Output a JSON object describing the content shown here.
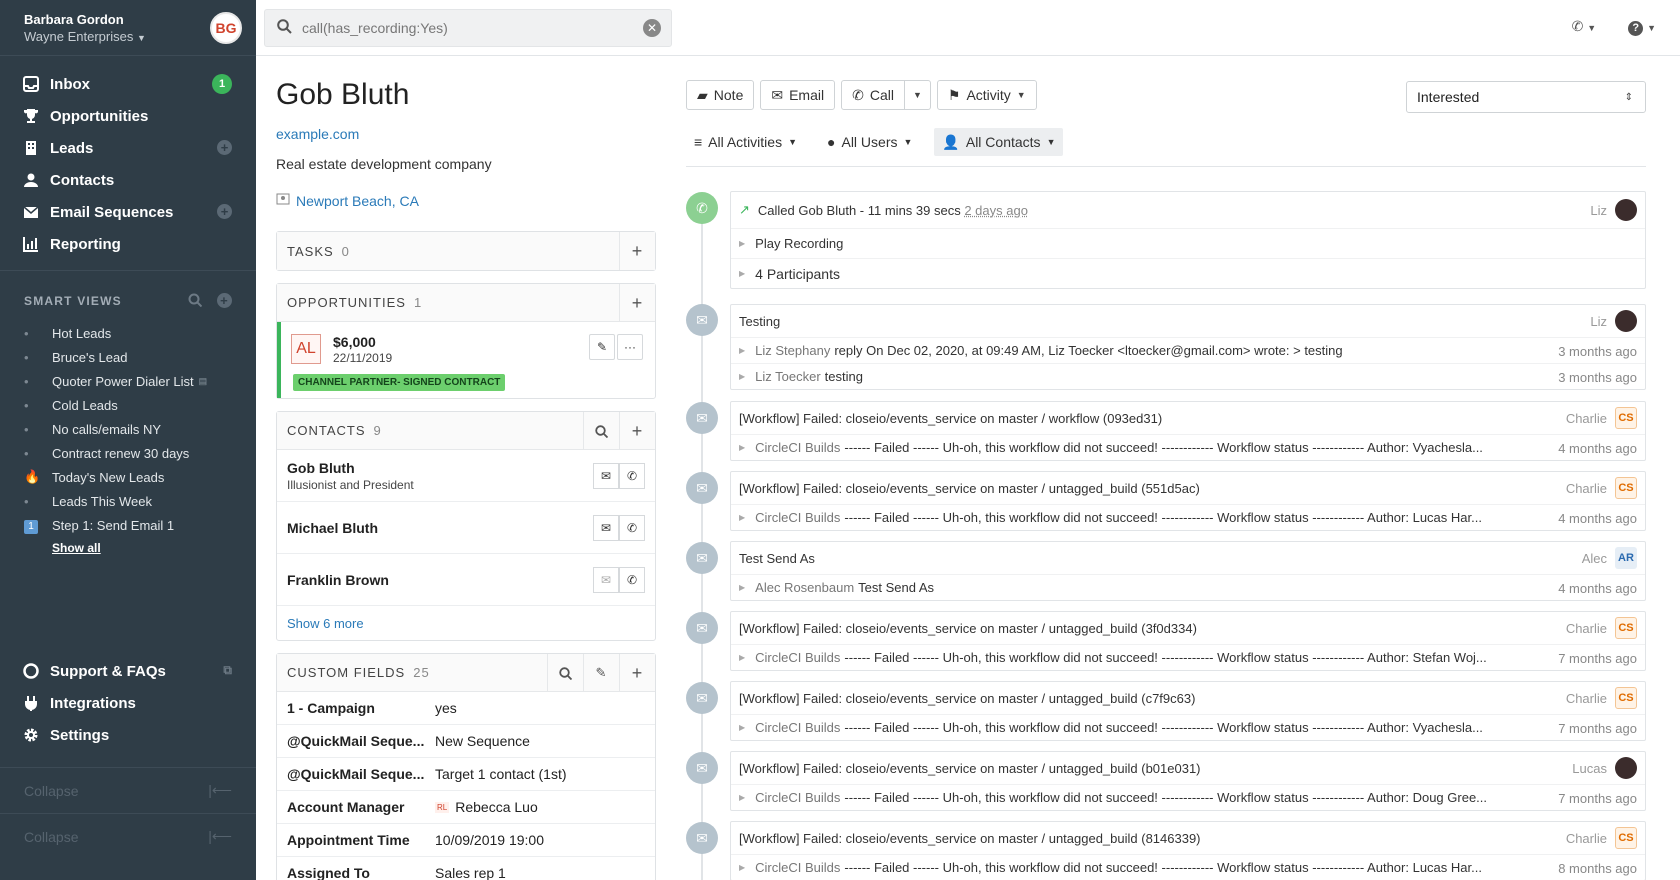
{
  "user": {
    "name": "Barbara Gordon",
    "org": "Wayne Enterprises",
    "initials": "BG"
  },
  "nav": {
    "inbox": "Inbox",
    "inbox_badge": "1",
    "opportunities": "Opportunities",
    "leads": "Leads",
    "contacts": "Contacts",
    "email_sequences": "Email Sequences",
    "reporting": "Reporting"
  },
  "smart_views": {
    "heading": "SMART VIEWS",
    "items": [
      "Hot Leads",
      "Bruce's Lead",
      "Quoter Power Dialer List",
      "Cold Leads",
      "No calls/emails NY",
      "Contract renew 30 days",
      "Today's New Leads",
      "Leads This Week",
      "Step 1: Send Email 1"
    ],
    "show_all": "Show all"
  },
  "bottom_nav": {
    "support": "Support & FAQs",
    "integrations": "Integrations",
    "settings": "Settings",
    "collapse": "Collapse"
  },
  "search": {
    "value": "call(has_recording:Yes)"
  },
  "lead": {
    "name": "Gob Bluth",
    "url": "example.com",
    "description": "Real estate development company",
    "location": "Newport Beach, CA"
  },
  "tasks": {
    "label": "TASKS",
    "count": "0"
  },
  "opportunities": {
    "label": "OPPORTUNITIES",
    "count": "1",
    "item": {
      "initials": "AL",
      "value": "$6,000",
      "date": "22/11/2019",
      "status": "CHANNEL PARTNER- SIGNED CONTRACT"
    }
  },
  "contacts": {
    "label": "CONTACTS",
    "count": "9",
    "items": [
      {
        "name": "Gob Bluth",
        "title": "Illusionist and President"
      },
      {
        "name": "Michael Bluth",
        "title": ""
      },
      {
        "name": "Franklin Brown",
        "title": ""
      }
    ],
    "show_more": "Show 6 more"
  },
  "custom_fields": {
    "label": "CUSTOM FIELDS",
    "count": "25",
    "rows": [
      {
        "key": "1 - Campaign",
        "value": "yes"
      },
      {
        "key": "@QuickMail Seque...",
        "value": "New Sequence"
      },
      {
        "key": "@QuickMail Seque...",
        "value": "Target 1 contact (1st)"
      },
      {
        "key": "Account Manager",
        "value": "Rebecca Luo",
        "badge": "RL"
      },
      {
        "key": "Appointment Time",
        "value": "10/09/2019 19:00"
      },
      {
        "key": "Assigned To",
        "value": "Sales rep 1"
      }
    ]
  },
  "actions": {
    "note": "Note",
    "email": "Email",
    "call": "Call",
    "activity": "Activity",
    "status": "Interested"
  },
  "filters": {
    "activities": "All Activities",
    "users": "All Users",
    "contacts": "All Contacts"
  },
  "feed": [
    {
      "type": "call",
      "title": "Called Gob Bluth - 11 mins 39 secs",
      "time": "2 days ago",
      "user": "Liz",
      "subs": [
        {
          "body": "Play Recording"
        },
        {
          "body": "4 Participants"
        }
      ]
    },
    {
      "type": "email",
      "title": "Testing",
      "user": "Liz",
      "subs": [
        {
          "who": "Liz Stephany",
          "body": "reply On Dec 02, 2020, at 09:49 AM, Liz Toecker <ltoecker@gmail.com> wrote: > testing",
          "time": "3 months ago"
        },
        {
          "who": "Liz Toecker",
          "body": "testing",
          "time": "3 months ago"
        }
      ]
    },
    {
      "type": "email",
      "title": "[Workflow] Failed: closeio/events_service on master / workflow (093ed31)",
      "user": "Charlie",
      "badge": "CS",
      "subs": [
        {
          "who": "CircleCI Builds",
          "body": "------ Failed ------ Uh-oh, this workflow did not succeed! ------------ Workflow status ------------ Author: Vyachesla...",
          "time": "4 months ago"
        }
      ]
    },
    {
      "type": "email",
      "title": "[Workflow] Failed: closeio/events_service on master / untagged_build (551d5ac)",
      "user": "Charlie",
      "badge": "CS",
      "subs": [
        {
          "who": "CircleCI Builds",
          "body": "------ Failed ------ Uh-oh, this workflow did not succeed! ------------ Workflow status ------------ Author: Lucas Har...",
          "time": "4 months ago"
        }
      ]
    },
    {
      "type": "email",
      "title": "Test Send As",
      "user": "Alec",
      "badge": "AR",
      "subs": [
        {
          "who": "Alec Rosenbaum",
          "body": "Test Send As",
          "time": "4 months ago"
        }
      ]
    },
    {
      "type": "email",
      "title": "[Workflow] Failed: closeio/events_service on master / untagged_build (3f0d334)",
      "user": "Charlie",
      "badge": "CS",
      "subs": [
        {
          "who": "CircleCI Builds",
          "body": "------ Failed ------ Uh-oh, this workflow did not succeed! ------------ Workflow status ------------ Author: Stefan Woj...",
          "time": "7 months ago"
        }
      ]
    },
    {
      "type": "email",
      "title": "[Workflow] Failed: closeio/events_service on master / untagged_build (c7f9c63)",
      "user": "Charlie",
      "badge": "CS",
      "subs": [
        {
          "who": "CircleCI Builds",
          "body": "------ Failed ------ Uh-oh, this workflow did not succeed! ------------ Workflow status ------------ Author: Vyachesla...",
          "time": "7 months ago"
        }
      ]
    },
    {
      "type": "email",
      "title": "[Workflow] Failed: closeio/events_service on master / untagged_build (b01e031)",
      "user": "Lucas",
      "subs": [
        {
          "who": "CircleCI Builds",
          "body": "------ Failed ------ Uh-oh, this workflow did not succeed! ------------ Workflow status ------------ Author: Doug Gree...",
          "time": "7 months ago"
        }
      ]
    },
    {
      "type": "email",
      "title": "[Workflow] Failed: closeio/events_service on master / untagged_build (8146339)",
      "user": "Charlie",
      "badge": "CS",
      "subs": [
        {
          "who": "CircleCI Builds",
          "body": "------ Failed ------ Uh-oh, this workflow did not succeed! ------------ Workflow status ------------ Author: Lucas Har...",
          "time": "8 months ago"
        }
      ]
    }
  ]
}
